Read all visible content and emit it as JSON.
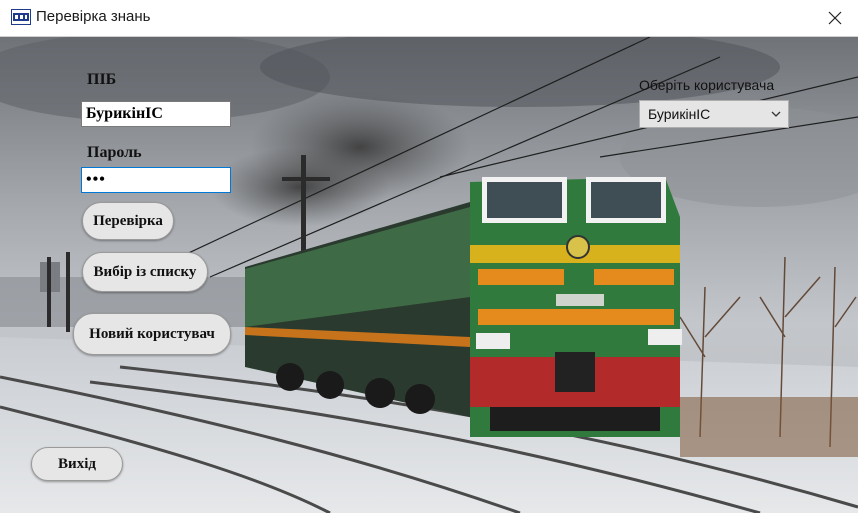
{
  "window": {
    "title": "Перевірка знань",
    "app_icon": "app-logo-icon",
    "close_icon": "close-icon"
  },
  "form": {
    "name_label": "ПІБ",
    "name_value": "БурикінІС",
    "password_label": "Пароль",
    "password_value": "•••",
    "check_button": "Перевірка",
    "choose_button": "Вибір із списку",
    "new_user_button": "Новий користувач",
    "exit_button": "Вихід"
  },
  "user_select": {
    "label": "Оберіть користувача",
    "selected": "БурикінІС",
    "arrow_icon": "chevron-down-icon"
  },
  "background": {
    "description_icon": "locomotive-photo",
    "colors": {
      "sky": "#8a8e94",
      "loco_green": "#2f7a3c",
      "loco_red": "#b22a2a",
      "stripe": "#e58a1c",
      "snow": "#d9dde2"
    }
  }
}
